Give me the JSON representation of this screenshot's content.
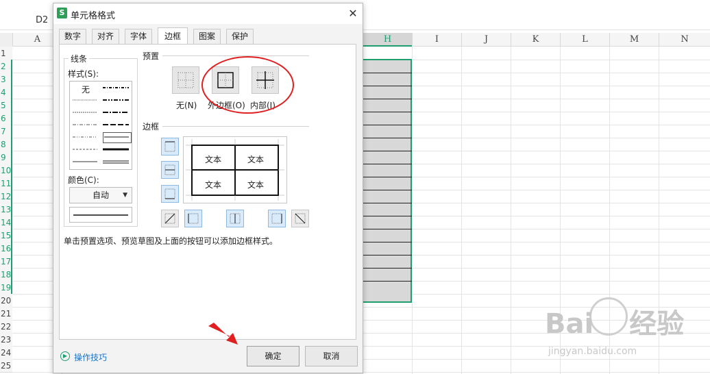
{
  "sheet": {
    "cell_ref": "D2",
    "columns": [
      "A",
      "H",
      "I",
      "J",
      "K",
      "L",
      "M",
      "N"
    ],
    "rows": [
      "1",
      "2",
      "3",
      "4",
      "5",
      "6",
      "7",
      "8",
      "9",
      "10",
      "11",
      "12",
      "13",
      "14",
      "15",
      "16",
      "17",
      "18",
      "19",
      "20",
      "21",
      "22",
      "23",
      "24",
      "25"
    ],
    "watermark": "Bai",
    "watermark_cn": "经验",
    "watermark_url": "jingyan.baidu.com"
  },
  "dialog": {
    "icon_letter": "S",
    "title": "单元格格式",
    "close": "✕",
    "tabs": [
      "数字",
      "对齐",
      "字体",
      "边框",
      "图案",
      "保护"
    ],
    "active_tab": "边框",
    "line_group": {
      "title": "线条",
      "style_label": "样式(S):",
      "none_label": "无",
      "color_label": "颜色(C):",
      "color_value": "自动"
    },
    "preset_group": {
      "title": "预置",
      "items": [
        "无(N)",
        "外边框(O)",
        "内部(I)"
      ]
    },
    "border_group": {
      "title": "边框",
      "cell_text": [
        "文本",
        "文本",
        "文本",
        "文本"
      ]
    },
    "hint": "单击预置选项、预览草图及上面的按钮可以添加边框样式。",
    "tips": "操作技巧",
    "ok": "确定",
    "cancel": "取消"
  },
  "colors": {
    "accent": "#1e9e6e",
    "annotation_red": "#e02020",
    "selected_button": "#d9ebfb"
  }
}
